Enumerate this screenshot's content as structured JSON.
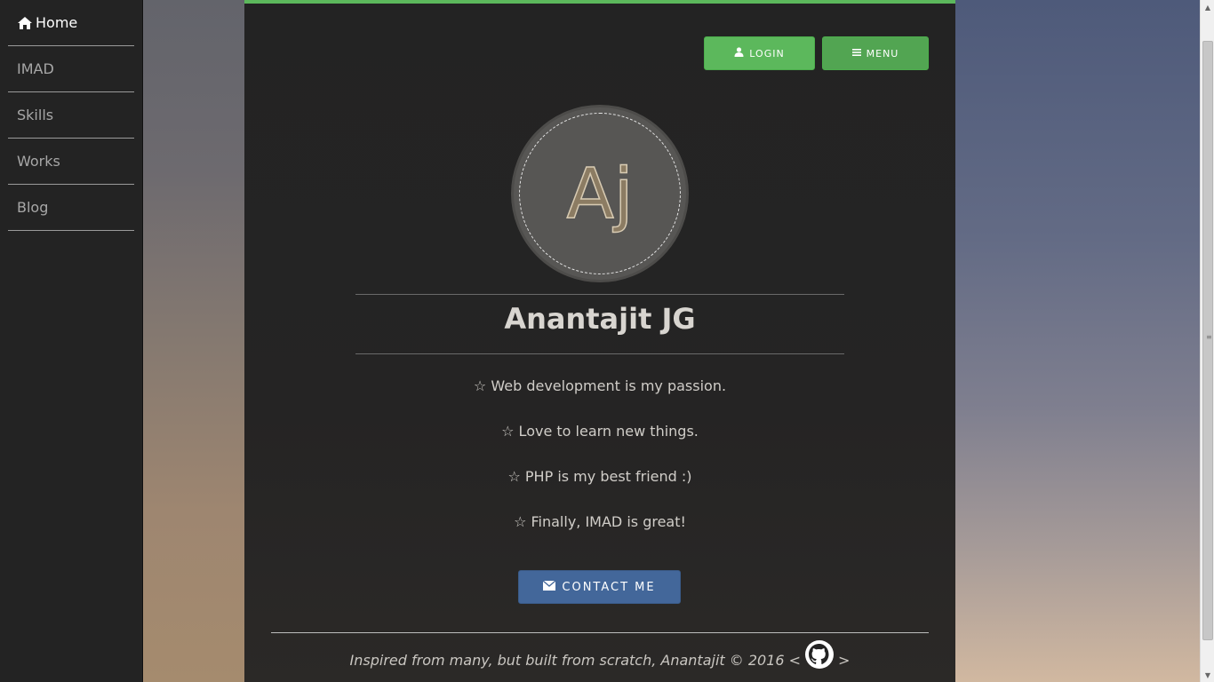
{
  "sidebar": {
    "items": [
      {
        "label": "Home"
      },
      {
        "label": "IMAD"
      },
      {
        "label": "Skills"
      },
      {
        "label": "Works"
      },
      {
        "label": "Blog"
      }
    ]
  },
  "header": {
    "login_label": "LOGIN",
    "menu_label": "MENU"
  },
  "profile": {
    "monogram": "Aj",
    "name": "Anantajit JG",
    "bullets": [
      "☆ Web development is my passion.",
      "☆ Love to learn new things.",
      "☆ PHP is my best friend :)",
      "☆ Finally, IMAD is great!"
    ],
    "contact_label": "CONTACT ME"
  },
  "footer": {
    "text": "Inspired from many, but built from scratch, Anantajit © 2016 <",
    "close": ">"
  },
  "colors": {
    "accent_green": "#5cb85c",
    "contact_blue": "#43679a",
    "panel_bg": "#232323"
  }
}
